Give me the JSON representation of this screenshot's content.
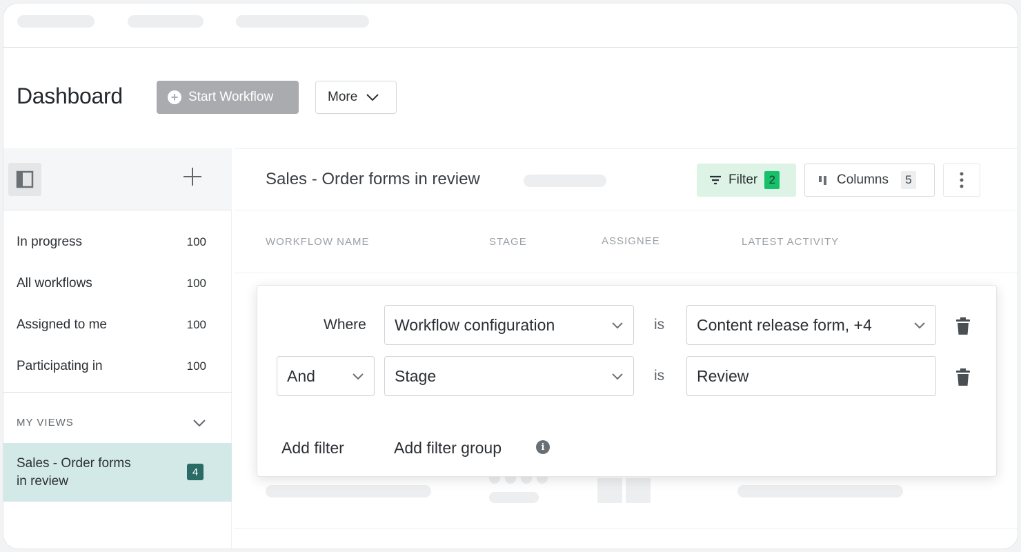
{
  "header": {
    "title": "Dashboard",
    "start_workflow_label": "Start Workflow",
    "more_label": "More"
  },
  "sidebar": {
    "items": [
      {
        "label": "In progress",
        "count": "100"
      },
      {
        "label": "All workflows",
        "count": "100"
      },
      {
        "label": "Assigned to me",
        "count": "100"
      },
      {
        "label": "Participating in",
        "count": "100"
      }
    ],
    "my_views_label": "MY VIEWS",
    "active_view": {
      "label": "Sales - Order forms in review",
      "badge": "4"
    }
  },
  "main": {
    "view_title": "Sales - Order forms in review",
    "filter_label": "Filter",
    "filter_count": "2",
    "columns_label": "Columns",
    "columns_count": "5",
    "column_headers": [
      "WORKFLOW NAME",
      "STAGE",
      "ASSIGNEE",
      "LATEST ACTIVITY"
    ]
  },
  "filter_popover": {
    "row1": {
      "connector": "Where",
      "field": "Workflow configuration",
      "operator": "is",
      "value": "Content release form, +4"
    },
    "row2": {
      "connector": "And",
      "field": "Stage",
      "operator": "is",
      "value": "Review"
    },
    "add_filter_label": "Add filter",
    "add_filter_group_label": "Add filter group"
  },
  "colors": {
    "filter_bg": "#dcf3e5",
    "filter_badge": "#17c16b",
    "active_view_bg": "#d3e9e8",
    "active_view_badge": "#2b6b66",
    "start_button": "#a9abae"
  }
}
